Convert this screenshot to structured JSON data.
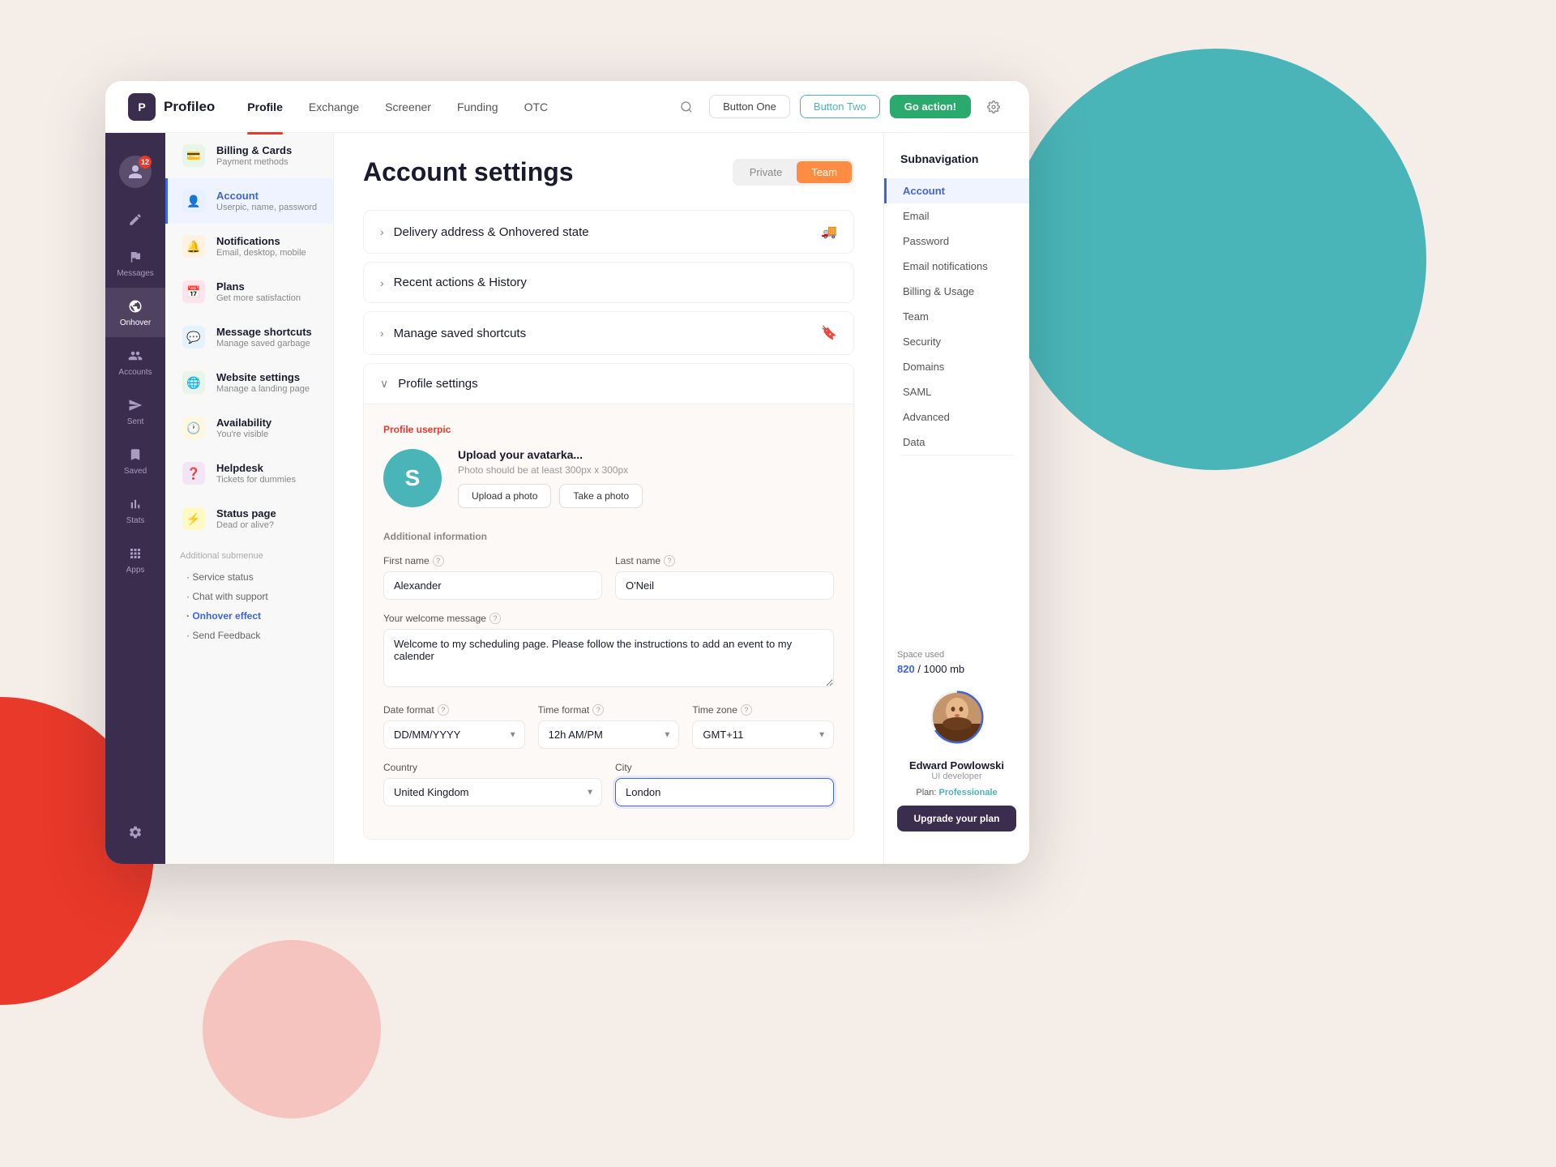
{
  "background": {
    "color": "#f5ede8"
  },
  "topnav": {
    "logo_letter": "P",
    "logo_text": "Profileo",
    "links": [
      {
        "label": "Profile",
        "active": true
      },
      {
        "label": "Exchange",
        "active": false
      },
      {
        "label": "Screener",
        "active": false
      },
      {
        "label": "Funding",
        "active": false
      },
      {
        "label": "OTC",
        "active": false
      }
    ],
    "btn_one_label": "Button One",
    "btn_two_label": "Button Two",
    "btn_action_label": "Go action!"
  },
  "icon_sidebar": {
    "items": [
      {
        "icon": "👤",
        "label": "",
        "badge": "12",
        "name": "avatar"
      },
      {
        "icon": "✏️",
        "label": "",
        "name": "edit"
      },
      {
        "icon": "🚩",
        "label": "Messages",
        "name": "messages"
      },
      {
        "icon": "🌐",
        "label": "Onhover",
        "name": "onhover",
        "active": true
      },
      {
        "icon": "👥",
        "label": "Accounts",
        "name": "accounts"
      },
      {
        "icon": "➤",
        "label": "Sent",
        "name": "sent"
      },
      {
        "icon": "🔖",
        "label": "Saved",
        "name": "saved"
      },
      {
        "icon": "📊",
        "label": "Stats",
        "name": "stats"
      },
      {
        "icon": "⊞",
        "label": "Apps",
        "name": "apps"
      }
    ],
    "bottom_icon": "⚙️"
  },
  "text_sidebar": {
    "items": [
      {
        "icon": "💳",
        "icon_class": "icon-card",
        "title": "Billing & Cards",
        "subtitle": "Payment methods",
        "active": false
      },
      {
        "icon": "👤",
        "icon_class": "icon-user",
        "title": "Account",
        "subtitle": "Userpic, name, password",
        "active": true
      },
      {
        "icon": "🔔",
        "icon_class": "icon-bell",
        "title": "Notifications",
        "subtitle": "Email, desktop, mobile",
        "active": false
      },
      {
        "icon": "📅",
        "icon_class": "icon-calendar",
        "title": "Plans",
        "subtitle": "Get more satisfaction",
        "active": false
      },
      {
        "icon": "💬",
        "icon_class": "icon-msg",
        "title": "Message shortcuts",
        "subtitle": "Manage saved garbage",
        "active": false
      },
      {
        "icon": "🌐",
        "icon_class": "icon-globe",
        "title": "Website settings",
        "subtitle": "Manage a landing page",
        "active": false
      },
      {
        "icon": "🕐",
        "icon_class": "icon-clock",
        "title": "Availability",
        "subtitle": "You're visible",
        "active": false
      },
      {
        "icon": "❓",
        "icon_class": "icon-help",
        "title": "Helpdesk",
        "subtitle": "Tickets for dummies",
        "active": false
      },
      {
        "icon": "⚡",
        "icon_class": "icon-status",
        "title": "Status page",
        "subtitle": "Dead or alive?",
        "active": false
      }
    ],
    "submenu_label": "Additional submenue",
    "submenu_items": [
      {
        "label": "Service status",
        "active": false
      },
      {
        "label": "Chat with support",
        "active": false
      },
      {
        "label": "Onhover effect",
        "active": true
      },
      {
        "label": "Send Feedback",
        "active": false
      }
    ]
  },
  "main": {
    "page_title": "Account settings",
    "toggle": {
      "private_label": "Private",
      "team_label": "Team",
      "active": "Team"
    },
    "accordion_items": [
      {
        "title": "Delivery address & Onhovered state",
        "icon_right": "🚚",
        "open": false
      },
      {
        "title": "Recent actions & History",
        "open": false
      },
      {
        "title": "Manage saved shortcuts",
        "icon_right": "🔖",
        "open": false
      }
    ],
    "profile_section": {
      "title": "Profile settings",
      "userpic_label": "Profile userpic",
      "avatar_letter": "S",
      "upload_title": "Upload your avatarka...",
      "upload_desc": "Photo should be at least 300px x 300px",
      "upload_btn": "Upload a photo",
      "take_btn": "Take a photo",
      "additional_label": "Additional information",
      "first_name_label": "First name",
      "first_name_value": "Alexander",
      "last_name_label": "Last name",
      "last_name_value": "O'Neil",
      "welcome_label": "Your welcome message",
      "welcome_value": "Welcome to my scheduling page. Please follow the instructions to add an event to my calender",
      "date_format_label": "Date format",
      "date_format_value": "DD/MM/YYYY",
      "time_format_label": "Time format",
      "time_format_value": "12h AM/PM",
      "timezone_label": "Time zone",
      "timezone_value": "GMT+11",
      "country_label": "Country",
      "country_value": "United Kingdom",
      "city_label": "City",
      "city_value": "London"
    }
  },
  "right_sidebar": {
    "title": "Subnavigation",
    "items": [
      {
        "label": "Account",
        "active": true
      },
      {
        "label": "Email",
        "active": false
      },
      {
        "label": "Password",
        "active": false
      },
      {
        "label": "Email notifications",
        "active": false
      },
      {
        "label": "Billing & Usage",
        "active": false
      },
      {
        "label": "Team",
        "active": false
      },
      {
        "label": "Security",
        "active": false
      },
      {
        "label": "Domains",
        "active": false
      },
      {
        "label": "SAML",
        "active": false
      },
      {
        "label": "Advanced",
        "active": false
      },
      {
        "label": "Data",
        "active": false
      }
    ],
    "storage_label": "Space used",
    "storage_used": "820",
    "storage_total": "/ 1000 mb",
    "user_name": "Edward Powlowski",
    "user_role": "UI developer",
    "plan_text": "Plan:",
    "plan_name": "Professionale",
    "upgrade_btn": "Upgrade your plan"
  }
}
